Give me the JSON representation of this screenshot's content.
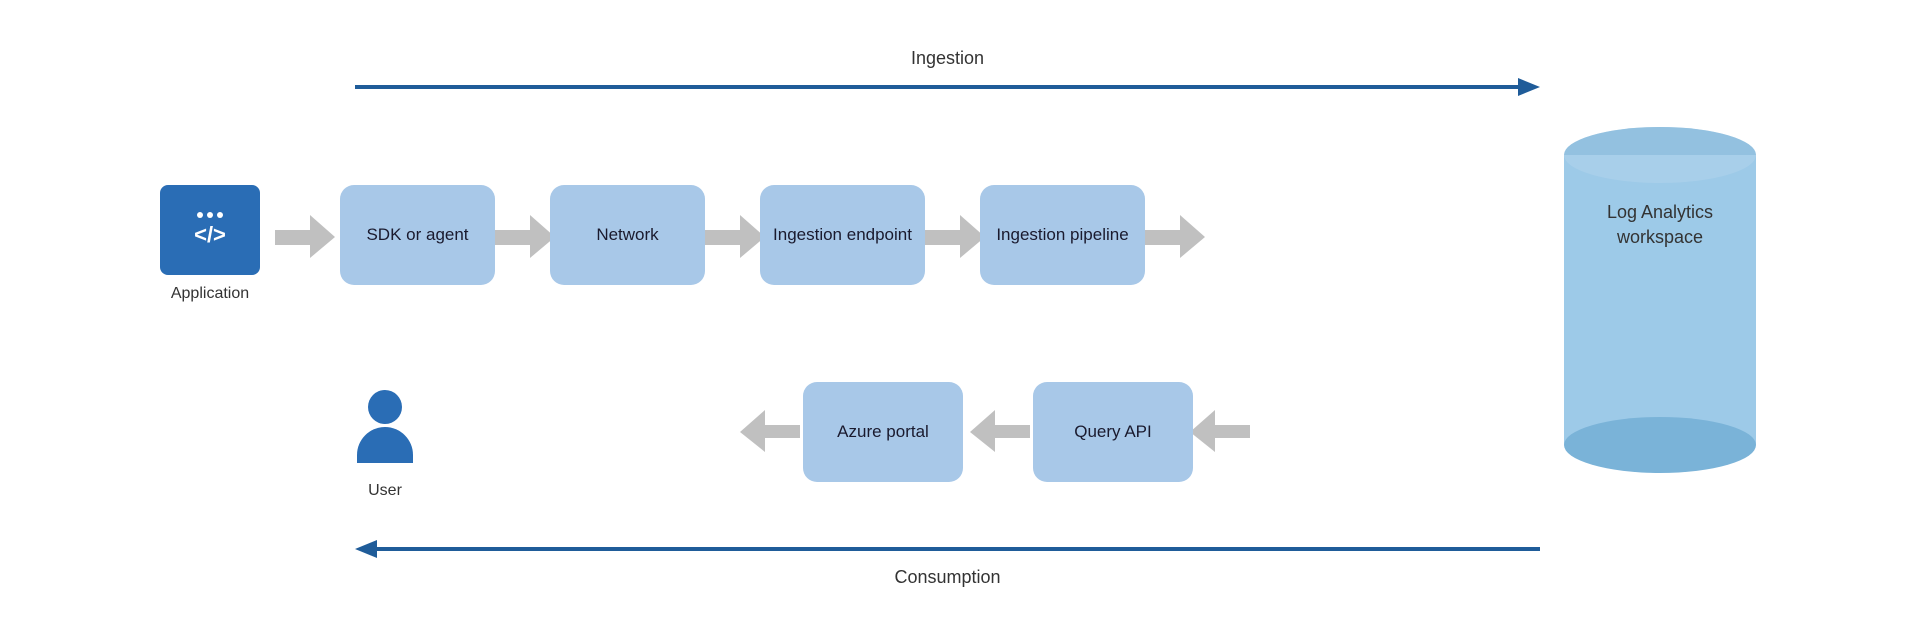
{
  "diagram": {
    "ingestion_label": "Ingestion",
    "consumption_label": "Consumption",
    "application_label": "Application",
    "user_label": "User",
    "db_label": "Log Analytics workspace",
    "boxes": {
      "sdk_agent": "SDK or agent",
      "network": "Network",
      "ingestion_endpoint": "Ingestion endpoint",
      "ingestion_pipeline": "Ingestion pipeline",
      "azure_portal": "Azure portal",
      "query_api": "Query API"
    }
  }
}
